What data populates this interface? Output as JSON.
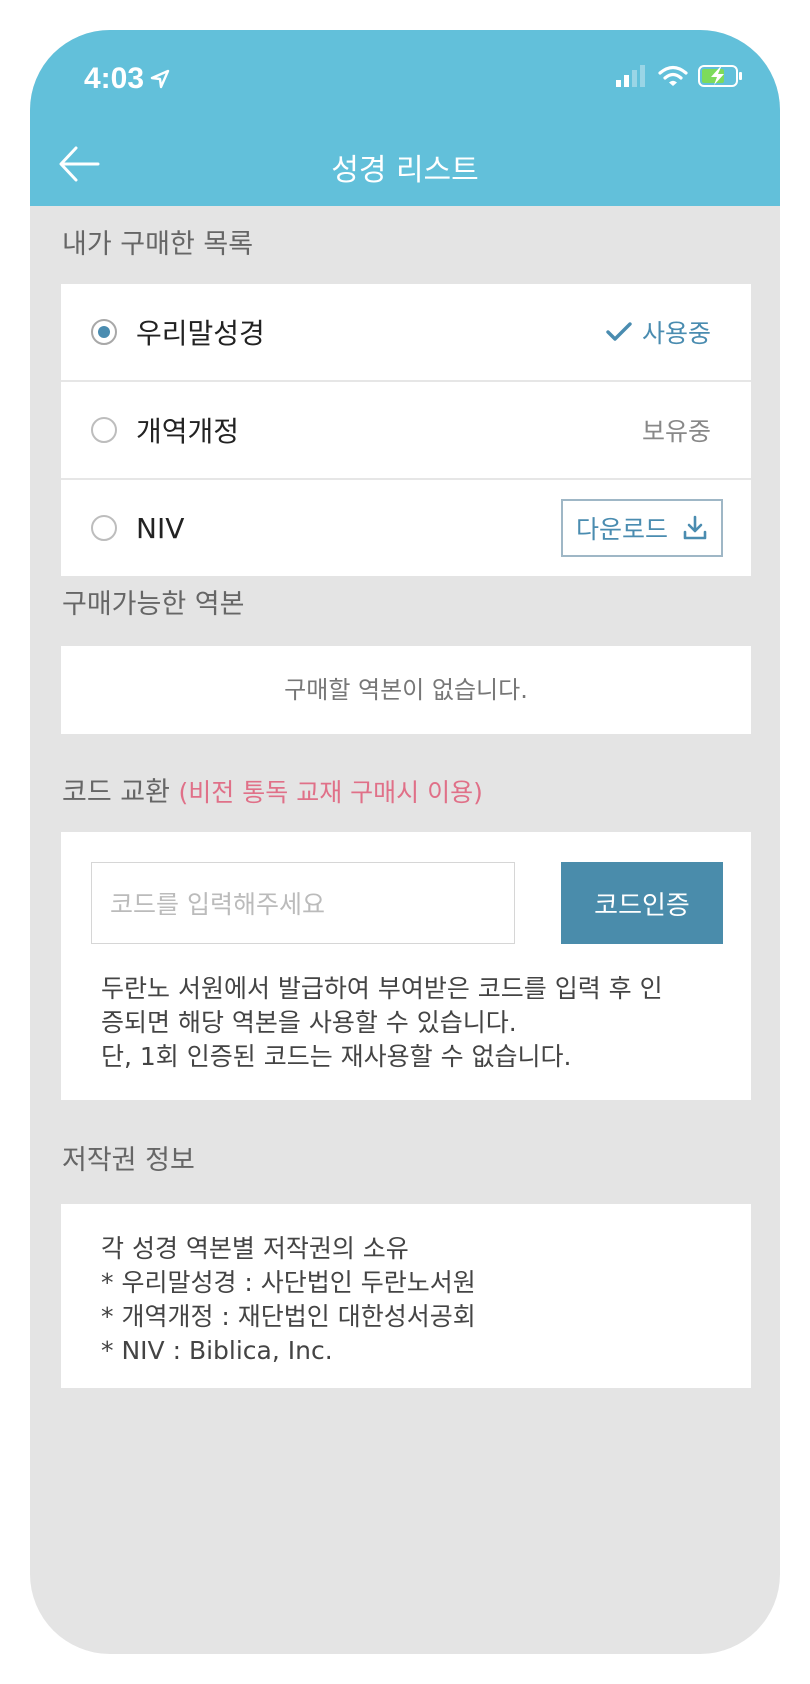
{
  "status_bar": {
    "time": "4:03"
  },
  "header": {
    "title": "성경 리스트"
  },
  "purchased": {
    "label": "내가 구매한 목록",
    "items": [
      {
        "name": "우리말성경",
        "status": "사용중",
        "selected": true
      },
      {
        "name": "개역개정",
        "status": "보유중",
        "selected": false
      },
      {
        "name": "NIV",
        "button": "다운로드",
        "selected": false
      }
    ]
  },
  "available": {
    "label": "구매가능한 역본",
    "empty": "구매할 역본이 없습니다."
  },
  "code": {
    "label": "코드 교환",
    "label_note": "(비전 통독 교재 구매시 이용)",
    "placeholder": "코드를 입력해주세요",
    "button": "코드인증",
    "desc_lines": [
      "두란노 서원에서 발급하여 부여받은 코드를 입력 후 인",
      "증되면 해당 역본을 사용할 수 있습니다.",
      "단, 1회 인증된 코드는 재사용할 수 없습니다."
    ]
  },
  "copyright": {
    "label": "저작권 정보",
    "lines": [
      "각 성경 역본별 저작권의 소유",
      "* 우리말성경 : 사단법인 두란노서원",
      "* 개역개정 : 재단법인 대한성서공회",
      "* NIV : Biblica, Inc."
    ]
  },
  "colors": {
    "header_bg": "#62c0da",
    "accent": "#4a8cb0",
    "note": "#e07088",
    "background": "#e4e4e4"
  }
}
